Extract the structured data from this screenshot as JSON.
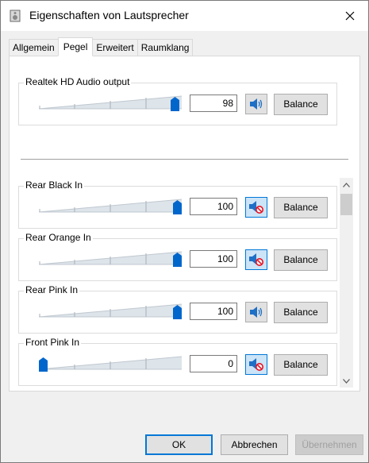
{
  "window": {
    "title": "Eigenschaften von Lautsprecher"
  },
  "tabs": [
    {
      "label": "Allgemein"
    },
    {
      "label": "Pegel"
    },
    {
      "label": "Erweitert"
    },
    {
      "label": "Raumklang"
    }
  ],
  "main": {
    "label": "Realtek HD Audio output",
    "value": "98",
    "level": 0.98,
    "muted": false,
    "balance_label": "Balance"
  },
  "channels": [
    {
      "label": "Rear Black In",
      "value": "100",
      "level": 1.0,
      "muted": true,
      "balance_label": "Balance"
    },
    {
      "label": "Rear Orange In",
      "value": "100",
      "level": 1.0,
      "muted": true,
      "balance_label": "Balance"
    },
    {
      "label": "Rear Pink In",
      "value": "100",
      "level": 1.0,
      "muted": false,
      "balance_label": "Balance"
    },
    {
      "label": "Front Pink In",
      "value": "0",
      "level": 0.0,
      "muted": true,
      "balance_label": "Balance"
    }
  ],
  "footer": {
    "ok": "OK",
    "cancel": "Abbrechen",
    "apply": "Übernehmen"
  },
  "colors": {
    "accent": "#0078d7",
    "thumb": "#0066cc",
    "mute_red": "#e81123"
  },
  "icons": {
    "title": "speaker-icon",
    "close": "close-icon",
    "speaker": "speaker-icon",
    "muted": "speaker-muted-icon"
  }
}
